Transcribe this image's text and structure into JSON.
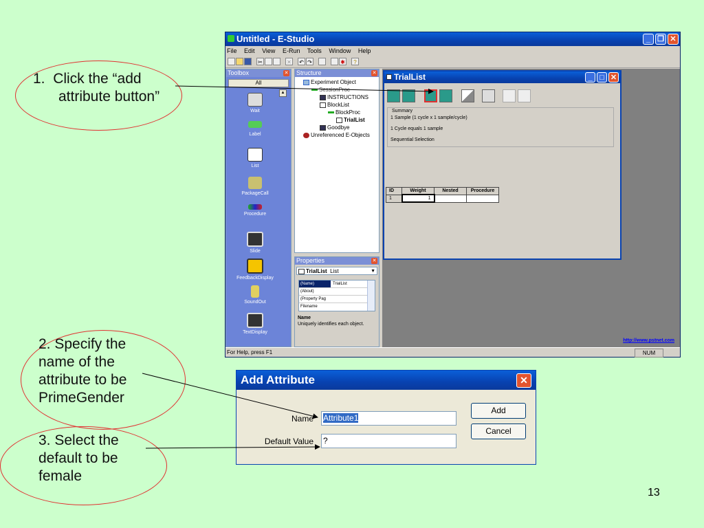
{
  "page_number": "13",
  "annotations": {
    "step1": {
      "number": "1.",
      "text_line1": "Click the “add",
      "text_line2": "attribute button”"
    },
    "step2": {
      "line1": "2. Specify the",
      "line2": "name of the",
      "line3": "attribute to be",
      "line4": "PrimeGender"
    },
    "step3": {
      "line1": "3. Select the",
      "line2": "default to be",
      "line3": "female"
    }
  },
  "estudio": {
    "title": "Untitled - E-Studio",
    "menu": [
      "File",
      "Edit",
      "View",
      "E-Run",
      "Tools",
      "Window",
      "Help"
    ],
    "toolbox": {
      "title": "Toolbox",
      "tab": "All",
      "items": [
        "Wait",
        "Label",
        "List",
        "PackageCall",
        "Procedure",
        "Slide",
        "FeedbackDisplay",
        "SoundOut",
        "TextDisplay"
      ]
    },
    "structure": {
      "title": "Structure",
      "items": [
        "Experiment Object",
        "SessionProc",
        "INSTRUCTIONS",
        "BlockList",
        "BlockProc",
        "TrialList",
        "Goodbye",
        "Unreferenced E-Objects"
      ]
    },
    "properties": {
      "title": "Properties",
      "object_name": "TrialList",
      "object_type": "List",
      "rows": [
        {
          "name": "(Name)",
          "value": "TrialList"
        },
        {
          "name": "(About)",
          "value": ""
        },
        {
          "name": "(Property Pag",
          "value": ""
        },
        {
          "name": "Filename",
          "value": ""
        }
      ],
      "desc_title": "Name",
      "desc_text": "Uniquely identifies each object."
    },
    "triallist": {
      "title": "TrialList",
      "summary_label": "Summary",
      "summary_lines": [
        "1 Sample (1 cycle x 1 sample/cycle)",
        "1 Cycle equals 1 sample",
        "Sequential Selection"
      ],
      "columns": [
        "ID",
        "Weight",
        "Nested",
        "Procedure"
      ],
      "rows": [
        [
          "1",
          "1",
          "",
          ""
        ]
      ]
    },
    "link": "http://www.pstnet.com",
    "status_left": "For Help, press F1",
    "status_right": "NUM"
  },
  "dialog": {
    "title": "Add Attribute",
    "name_label": "Name",
    "name_value": "Attribute1",
    "default_label": "Default Value",
    "default_value": "?",
    "add_label": "Add",
    "cancel_label": "Cancel"
  }
}
